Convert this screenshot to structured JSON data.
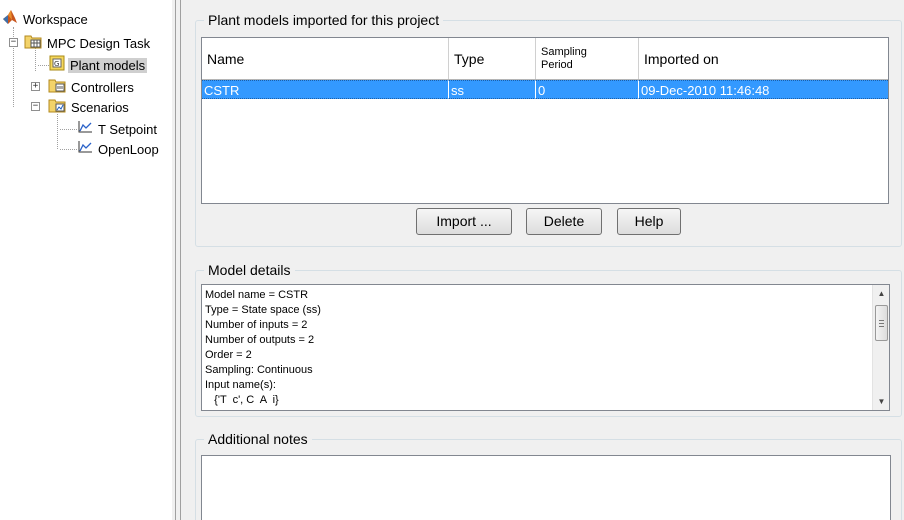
{
  "tree": {
    "workspace": "Workspace",
    "task": "MPC Design Task",
    "plant_models": "Plant models",
    "controllers": "Controllers",
    "scenarios": "Scenarios",
    "scenario_items": [
      "T Setpoint",
      "OpenLoop"
    ]
  },
  "plant_group": {
    "title": "Plant models imported for this project",
    "columns": [
      "Name",
      "Type",
      "Sampling\nPeriod",
      "Imported on"
    ],
    "rows": [
      {
        "name": "CSTR",
        "type": "ss",
        "period": "0",
        "imported_on": "09-Dec-2010 11:46:48"
      }
    ],
    "buttons": {
      "import": "Import ...",
      "delete": "Delete",
      "help": "Help"
    }
  },
  "details": {
    "title": "Model details",
    "lines": [
      "Model name = CSTR",
      "Type = State space (ss)",
      "Number of inputs = 2",
      "Number of outputs = 2",
      "Order = 2",
      "Sampling: Continuous",
      "Input name(s):",
      "   {'T  c', C  A  i}"
    ]
  },
  "notes": {
    "title": "Additional notes",
    "value": ""
  },
  "colors": {
    "selection": "#3399ff",
    "panel": "#f0f0f0"
  }
}
